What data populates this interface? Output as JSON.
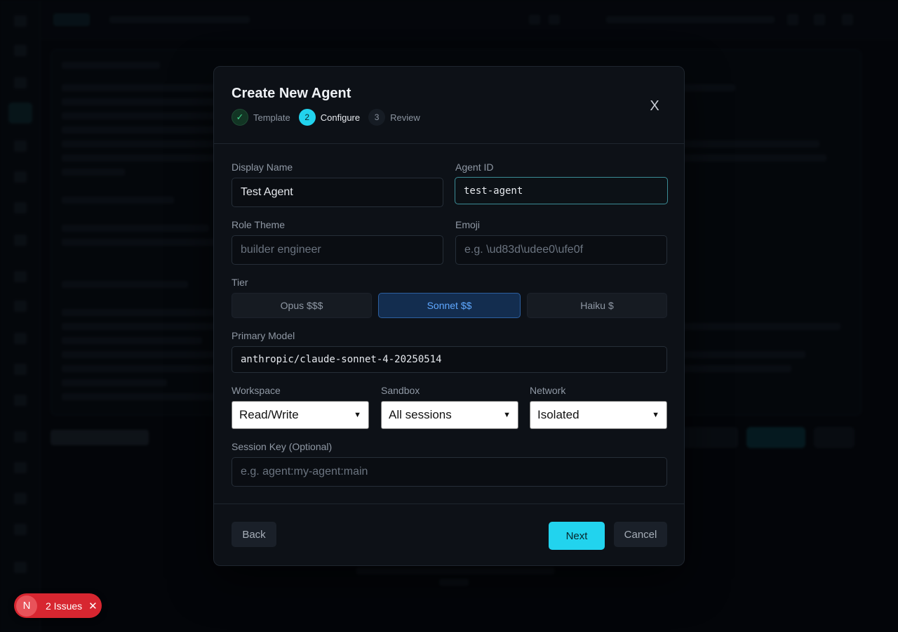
{
  "modal": {
    "title": "Create New Agent",
    "close_label": "X",
    "steps": [
      {
        "number": "✓",
        "label": "Template",
        "state": "done"
      },
      {
        "number": "2",
        "label": "Configure",
        "state": "current"
      },
      {
        "number": "3",
        "label": "Review",
        "state": "pending"
      }
    ],
    "fields": {
      "display_name": {
        "label": "Display Name",
        "value": "Test Agent"
      },
      "agent_id": {
        "label": "Agent ID",
        "value": "test-agent"
      },
      "role_theme": {
        "label": "Role Theme",
        "placeholder": "builder engineer"
      },
      "emoji": {
        "label": "Emoji",
        "placeholder": "e.g. \\ud83d\\udee0\\ufe0f"
      },
      "tier": {
        "label": "Tier",
        "options": [
          "Opus $$$",
          "Sonnet $$",
          "Haiku $"
        ],
        "selected": "Sonnet $$"
      },
      "primary_model": {
        "label": "Primary Model",
        "value": "anthropic/claude-sonnet-4-20250514"
      },
      "workspace": {
        "label": "Workspace",
        "value": "Read/Write"
      },
      "sandbox": {
        "label": "Sandbox",
        "value": "All sessions"
      },
      "network": {
        "label": "Network",
        "value": "Isolated"
      },
      "session_key": {
        "label": "Session Key (Optional)",
        "placeholder": "e.g. agent:my-agent:main"
      }
    },
    "footer": {
      "back": "Back",
      "next": "Next",
      "cancel": "Cancel"
    }
  },
  "issues_badge": {
    "logo": "N",
    "text": "2 Issues",
    "close": "✕"
  },
  "colors": {
    "accent": "#22d3ee",
    "tier_selected": "#5fa8ff",
    "issues": "#d72630"
  }
}
